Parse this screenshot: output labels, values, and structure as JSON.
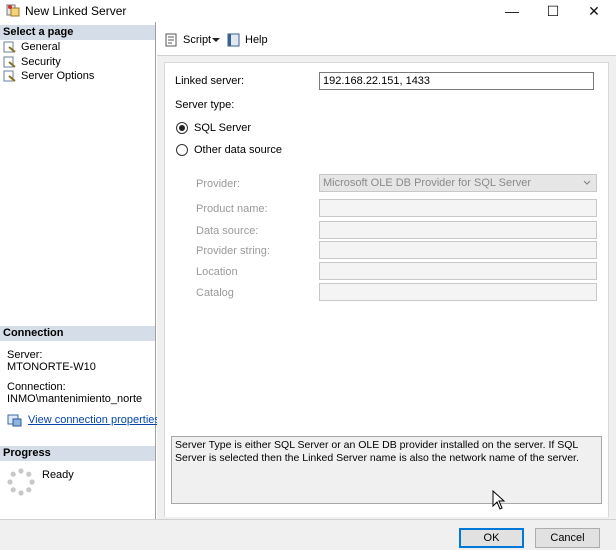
{
  "window": {
    "title": "New Linked Server",
    "minimize_glyph": "—",
    "maximize_glyph": "☐",
    "close_glyph": "✕"
  },
  "left": {
    "select_page_header": "Select a page",
    "pages": [
      {
        "label": "General",
        "icon": "page-wrench-icon"
      },
      {
        "label": "Security",
        "icon": "page-wrench-icon"
      },
      {
        "label": "Server Options",
        "icon": "page-wrench-icon"
      }
    ],
    "connection_header": "Connection",
    "server_label": "Server:",
    "server_value": "MTONORTE-W10",
    "connection_label": "Connection:",
    "connection_value": "INMO\\mantenimiento_norte",
    "view_props_link": "View connection properties",
    "progress_header": "Progress",
    "progress_status": "Ready"
  },
  "toolbar": {
    "script_label": "Script",
    "help_label": "Help"
  },
  "form": {
    "linked_server_label": "Linked server:",
    "linked_server_value": "192.168.22.151, 1433",
    "server_type_label": "Server type:",
    "sql_server_option": "SQL Server",
    "other_source_option": "Other data source",
    "sql_server_selected": true,
    "provider_label": "Provider:",
    "provider_value": "Microsoft OLE DB Provider for SQL Server",
    "product_name_label": "Product name:",
    "data_source_label": "Data source:",
    "provider_string_label": "Provider string:",
    "location_label": "Location",
    "catalog_label": "Catalog",
    "description": "Server Type is either SQL Server or an OLE DB provider installed on the server. If SQL Server is selected then the Linked Server name is also the network name of the server."
  },
  "footer": {
    "ok_label": "OK",
    "cancel_label": "Cancel"
  },
  "colors": {
    "section_header_bg": "#d5dde8",
    "link": "#0645ad",
    "default_button_border": "#0078d7"
  }
}
